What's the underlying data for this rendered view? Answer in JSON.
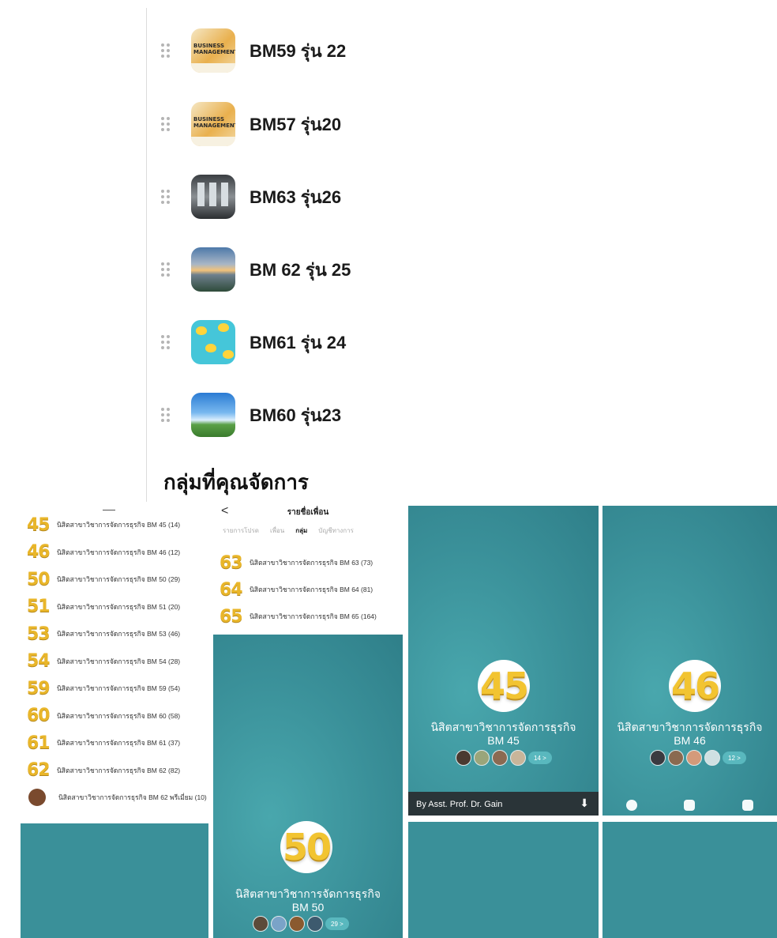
{
  "groups": [
    {
      "name": "BM59 รุ่น 22",
      "thumb": "business-management"
    },
    {
      "name": "BM57 รุ่น20",
      "thumb": "business-management"
    },
    {
      "name": "BM63 รุ่น26",
      "thumb": "room-photo"
    },
    {
      "name": "BM 62 รุ่น 25",
      "thumb": "sunset-photo"
    },
    {
      "name": "BM61 รุ่น 24",
      "thumb": "ducks-pattern"
    },
    {
      "name": "BM60 รุ่น23",
      "thumb": "sky-photo"
    }
  ],
  "thumb_text": {
    "line1": "BUSINESS",
    "line2": "MANAGEMENT"
  },
  "section_title": "กลุ่มที่คุณจัดการ",
  "collage": {
    "list_a": [
      {
        "num": "45",
        "text": "นิสิตสาขาวิชาการจัดการธุรกิจ BM 45 (14)"
      },
      {
        "num": "46",
        "text": "นิสิตสาขาวิชาการจัดการธุรกิจ BM 46 (12)"
      },
      {
        "num": "50",
        "text": "นิสิตสาขาวิชาการจัดการธุรกิจ BM 50 (29)"
      },
      {
        "num": "51",
        "text": "นิสิตสาขาวิชาการจัดการธุรกิจ BM 51 (20)"
      },
      {
        "num": "53",
        "text": "นิสิตสาขาวิชาการจัดการธุรกิจ BM 53 (46)"
      },
      {
        "num": "54",
        "text": "นิสิตสาขาวิชาการจัดการธุรกิจ BM 54 (28)"
      },
      {
        "num": "59",
        "text": "นิสิตสาขาวิชาการจัดการธุรกิจ BM 59 (54)"
      },
      {
        "num": "60",
        "text": "นิสิตสาขาวิชาการจัดการธุรกิจ BM 60 (58)"
      },
      {
        "num": "61",
        "text": "นิสิตสาขาวิชาการจัดการธุรกิจ BM 61 (37)"
      },
      {
        "num": "62",
        "text": "นิสิตสาขาวิชาการจัดการธุรกิจ BM 62 (82)"
      },
      {
        "num": "",
        "text": "นิสิตสาขาวิชาการจัดการธุรกิจ BM 62 พรีเมี่ยม (10)"
      }
    ],
    "friends_panel": {
      "back": "<",
      "title": "รายชื่อเพื่อน",
      "tabs": [
        "รายการโปรด",
        "เพื่อน",
        "กลุ่ม",
        "บัญชีทางการ"
      ],
      "active_tab": 2,
      "items": [
        {
          "num": "63",
          "text": "นิสิตสาขาวิชาการจัดการธุรกิจ BM 63 (73)"
        },
        {
          "num": "64",
          "text": "นิสิตสาขาวิชาการจัดการธุรกิจ BM 64 (81)"
        },
        {
          "num": "65",
          "text": "นิสิตสาขาวิชาการจัดการธุรกิจ BM 65 (164)"
        }
      ]
    },
    "card_50": {
      "badge": "50",
      "title": "นิสิตสาขาวิชาการจัดการธุรกิจ",
      "subtitle": "BM 50",
      "count": "29 >"
    },
    "card_45": {
      "badge": "45",
      "title": "นิสิตสาขาวิชาการจัดการธุรกิจ",
      "subtitle": "BM 45",
      "count": "14 >",
      "bar_text": "By Asst. Prof. Dr. Gain"
    },
    "card_46": {
      "badge": "46",
      "title": "นิสิตสาขาวิชาการจัดการธุรกิจ",
      "subtitle": "BM 46",
      "count": "12 >"
    }
  },
  "colors": {
    "teal": "#3a9099",
    "gold": "#e9b62a",
    "accent_dark": "#2a3438"
  }
}
